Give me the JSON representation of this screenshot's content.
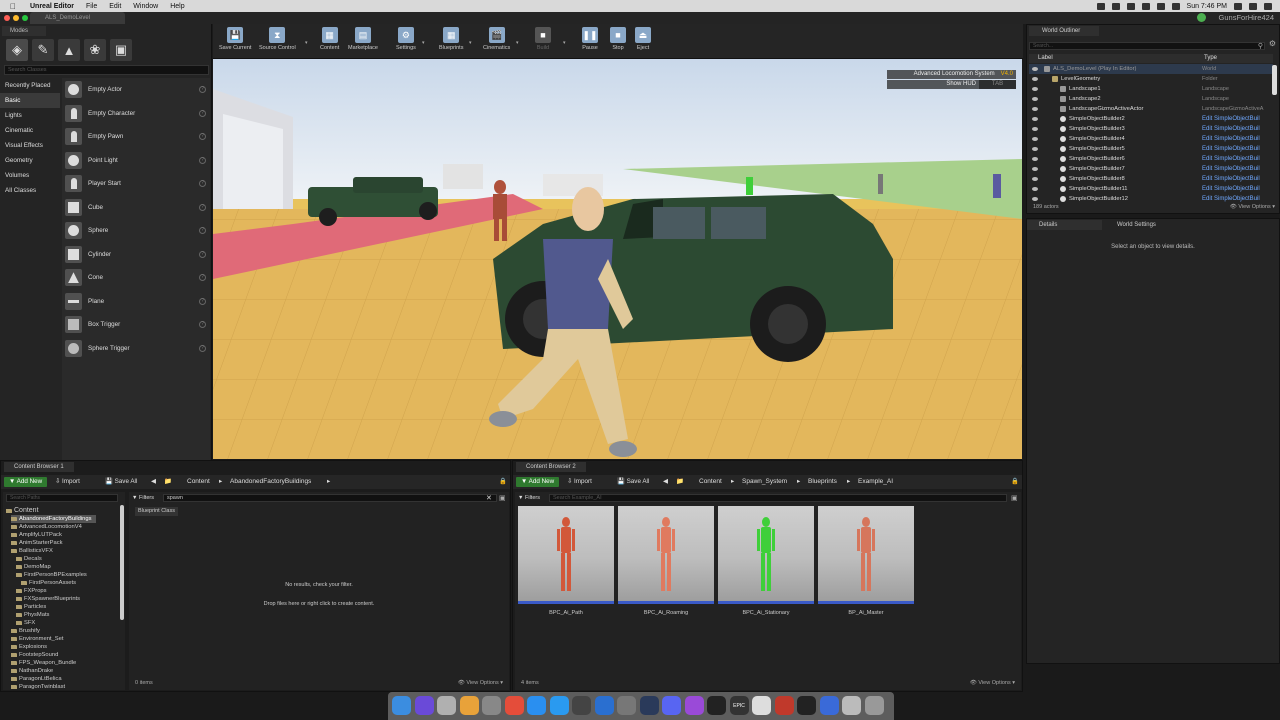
{
  "menubar": {
    "app_name": "Unreal Editor",
    "menus": [
      "File",
      "Edit",
      "Window",
      "Help"
    ],
    "clock": "Sun 7:46 PM"
  },
  "window": {
    "tab_title": "ALS_DemoLevel",
    "user": "GunsForHire424"
  },
  "modes": {
    "tab": "Modes",
    "search_placeholder": "Search Classes",
    "categories": [
      "Recently Placed",
      "Basic",
      "Lights",
      "Cinematic",
      "Visual Effects",
      "Geometry",
      "Volumes",
      "All Classes"
    ],
    "active_category": "Basic",
    "items": [
      {
        "label": "Empty Actor",
        "icon": "sphere-icon"
      },
      {
        "label": "Empty Character",
        "icon": "character-icon"
      },
      {
        "label": "Empty Pawn",
        "icon": "pawn-icon"
      },
      {
        "label": "Point Light",
        "icon": "point-light-icon"
      },
      {
        "label": "Player Start",
        "icon": "player-start-icon"
      },
      {
        "label": "Cube",
        "icon": "cube-icon"
      },
      {
        "label": "Sphere",
        "icon": "sphere-icon"
      },
      {
        "label": "Cylinder",
        "icon": "cylinder-icon"
      },
      {
        "label": "Cone",
        "icon": "cone-icon"
      },
      {
        "label": "Plane",
        "icon": "plane-icon"
      },
      {
        "label": "Box Trigger",
        "icon": "box-trigger-icon"
      },
      {
        "label": "Sphere Trigger",
        "icon": "sphere-trigger-icon"
      }
    ]
  },
  "toolbar": {
    "items": [
      {
        "label": "Save Current",
        "icon": "save-icon"
      },
      {
        "label": "Source Control",
        "icon": "source-control-icon"
      },
      {
        "label": "Content",
        "icon": "content-icon"
      },
      {
        "label": "Marketplace",
        "icon": "marketplace-icon"
      },
      {
        "label": "Settings",
        "icon": "settings-icon"
      },
      {
        "label": "Blueprints",
        "icon": "blueprints-icon"
      },
      {
        "label": "Cinematics",
        "icon": "cinematics-icon"
      },
      {
        "label": "Build",
        "icon": "build-icon"
      },
      {
        "label": "Pause",
        "icon": "pause-icon"
      },
      {
        "label": "Stop",
        "icon": "stop-icon"
      },
      {
        "label": "Eject",
        "icon": "eject-icon"
      }
    ]
  },
  "viewport": {
    "hud_title": "Advanced Locomotion System",
    "hud_version": "V4.0",
    "hud_show": "Show HUD",
    "hud_key": "TAB"
  },
  "outliner": {
    "tab": "World Outliner",
    "search_placeholder": "Search...",
    "col_label": "Label",
    "col_type": "Type",
    "rows": [
      {
        "name": "ALS_DemoLevel (Play In Editor)",
        "type": "World",
        "indent": 0
      },
      {
        "name": "LevelGeometry",
        "type": "Folder",
        "indent": 1
      },
      {
        "name": "Landscape1",
        "type": "Landscape",
        "indent": 2
      },
      {
        "name": "Landscape2",
        "type": "Landscape",
        "indent": 2
      },
      {
        "name": "LandscapeGizmoActiveActor",
        "type": "LandscapeGizmoActiveA",
        "indent": 2
      },
      {
        "name": "SimpleObjectBuilder2",
        "type": "Edit SimpleObjectBuil",
        "indent": 2
      },
      {
        "name": "SimpleObjectBuilder3",
        "type": "Edit SimpleObjectBuil",
        "indent": 2
      },
      {
        "name": "SimpleObjectBuilder4",
        "type": "Edit SimpleObjectBuil",
        "indent": 2
      },
      {
        "name": "SimpleObjectBuilder5",
        "type": "Edit SimpleObjectBuil",
        "indent": 2
      },
      {
        "name": "SimpleObjectBuilder6",
        "type": "Edit SimpleObjectBuil",
        "indent": 2
      },
      {
        "name": "SimpleObjectBuilder7",
        "type": "Edit SimpleObjectBuil",
        "indent": 2
      },
      {
        "name": "SimpleObjectBuilder8",
        "type": "Edit SimpleObjectBuil",
        "indent": 2
      },
      {
        "name": "SimpleObjectBuilder11",
        "type": "Edit SimpleObjectBuil",
        "indent": 2
      },
      {
        "name": "SimpleObjectBuilder12",
        "type": "Edit SimpleObjectBuil",
        "indent": 2
      }
    ],
    "count": "189 actors",
    "view_options": "View Options"
  },
  "details": {
    "tab1": "Details",
    "tab2": "World Settings",
    "message": "Select an object to view details."
  },
  "cb1": {
    "tab": "Content Browser 1",
    "add_new": "Add New",
    "import": "Import",
    "save_all": "Save All",
    "crumbs": [
      "Content",
      "AbandonedFactoryBuildings"
    ],
    "paths_placeholder": "Search Paths",
    "filters": "Filters",
    "search_value": "spawn",
    "chip": "Blueprint Class",
    "empty1": "No results, check your filter.",
    "empty2": "Drop files here or right click to create content.",
    "count": "0 items",
    "view_options": "View Options",
    "tree": [
      {
        "label": "Content",
        "indent": 0,
        "sel": false,
        "big": true
      },
      {
        "label": "AbandonedFactoryBuildings",
        "indent": 1,
        "sel": true
      },
      {
        "label": "AdvancedLocomotionV4",
        "indent": 1
      },
      {
        "label": "AmplifyLUTPack",
        "indent": 1
      },
      {
        "label": "AnimStarterPack",
        "indent": 1
      },
      {
        "label": "BallisticsVFX",
        "indent": 1
      },
      {
        "label": "Decals",
        "indent": 2
      },
      {
        "label": "DemoMap",
        "indent": 2
      },
      {
        "label": "FirstPersonBPExamples",
        "indent": 2
      },
      {
        "label": "FirstPersonAssets",
        "indent": 3
      },
      {
        "label": "FXProps",
        "indent": 2
      },
      {
        "label": "FXSpawnerBlueprints",
        "indent": 2
      },
      {
        "label": "Particles",
        "indent": 2
      },
      {
        "label": "PhysMats",
        "indent": 2
      },
      {
        "label": "SFX",
        "indent": 2
      },
      {
        "label": "Brushify",
        "indent": 1
      },
      {
        "label": "Environment_Set",
        "indent": 1
      },
      {
        "label": "Explosions",
        "indent": 1
      },
      {
        "label": "FootstepSound",
        "indent": 1
      },
      {
        "label": "FPS_Weapon_Bundle",
        "indent": 1
      },
      {
        "label": "NathanDrake",
        "indent": 1
      },
      {
        "label": "ParagonLtBelica",
        "indent": 1
      },
      {
        "label": "ParagonTwinblast",
        "indent": 1
      }
    ]
  },
  "cb2": {
    "tab": "Content Browser 2",
    "add_new": "Add New",
    "import": "Import",
    "save_all": "Save All",
    "crumbs": [
      "Content",
      "Spawn_System",
      "Blueprints",
      "Example_AI"
    ],
    "filters": "Filters",
    "search_placeholder": "Search Example_AI",
    "assets": [
      {
        "name": "BPC_Ai_Path",
        "color": "#d2583a"
      },
      {
        "name": "BPC_Ai_Roaming",
        "color": "#e07a5f"
      },
      {
        "name": "BPC_Ai_Stationary",
        "color": "#3fcf3a"
      },
      {
        "name": "BP_Ai_Master",
        "color": "#d6765c"
      }
    ],
    "count": "4 items",
    "view_options": "View Options"
  },
  "dock": {
    "apps": [
      "finder-icon",
      "siri-icon",
      "launchpad-icon",
      "photos-icon",
      "preferences-icon",
      "chrome-icon",
      "appstore-icon",
      "safari-icon",
      "vectorworks-icon",
      "xcode-icon",
      "help-icon",
      "steam-icon",
      "discord-icon",
      "podcasts-icon",
      "appletv-icon",
      "epic-games-icon",
      "ghost-icon",
      "photo-booth-icon",
      "unreal-icon",
      "app-icon",
      "preview-icon",
      "trash-icon"
    ],
    "epic_label": "EPIC"
  }
}
